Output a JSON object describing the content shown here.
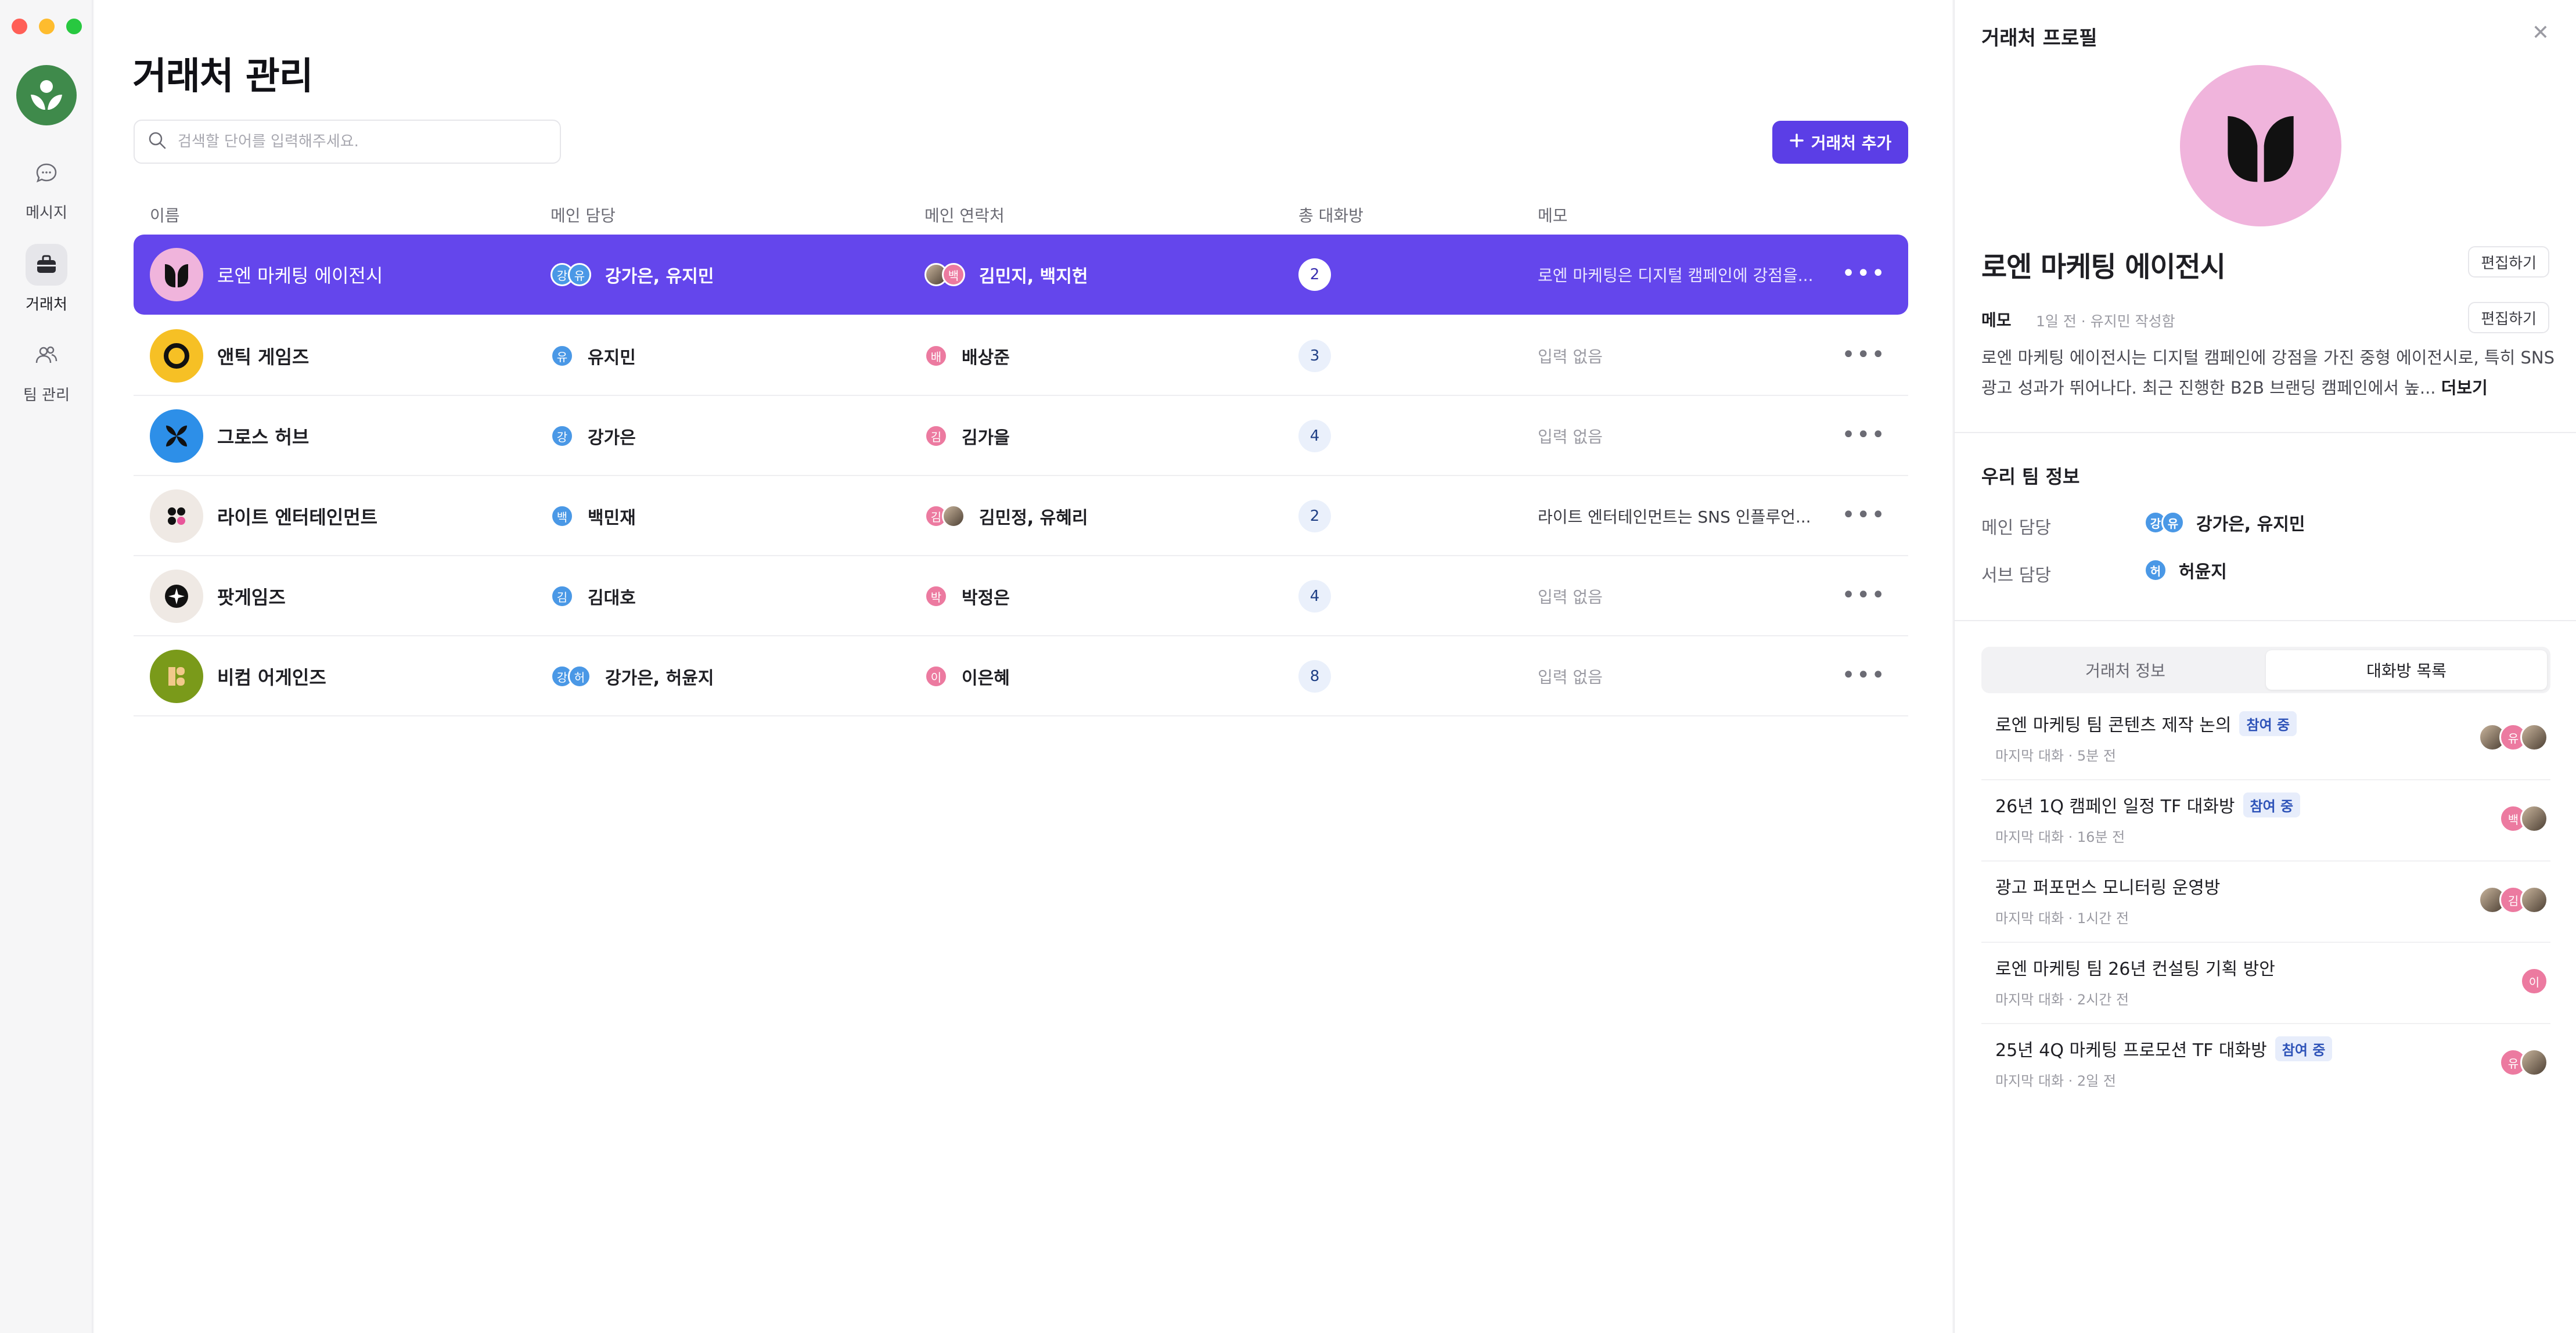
{
  "sidebar": {
    "items": [
      {
        "label": "메시지",
        "icon": "chat-bubble-icon",
        "active": false
      },
      {
        "label": "거래처",
        "icon": "briefcase-icon",
        "active": true
      },
      {
        "label": "팀 관리",
        "icon": "people-icon",
        "active": false
      }
    ]
  },
  "main": {
    "title": "거래처 관리",
    "search_placeholder": "검색할 단어를 입력해주세요.",
    "add_button": "거래처 추가",
    "columns": [
      "이름",
      "메인 담당",
      "메인 연락처",
      "총 대화방",
      "메모"
    ],
    "rows": [
      {
        "name": "로엔 마케팅 에이전시",
        "managers": "강가은, 유지민",
        "manager_initials": [
          "강",
          "유"
        ],
        "contacts": "김민지, 백지헌",
        "contact_initials": [
          "",
          "백"
        ],
        "count": "2",
        "memo": "로엔 마케팅은 디지털 캠페인에 강점을...",
        "memo_filled": true,
        "selected": true
      },
      {
        "name": "앤틱 게임즈",
        "managers": "유지민",
        "manager_initials": [
          "유"
        ],
        "contacts": "배상준",
        "contact_initials": [
          "배"
        ],
        "count": "3",
        "memo": "입력 없음",
        "memo_filled": false
      },
      {
        "name": "그로스 허브",
        "managers": "강가은",
        "manager_initials": [
          "강"
        ],
        "contacts": "김가을",
        "contact_initials": [
          "김"
        ],
        "count": "4",
        "memo": "입력 없음",
        "memo_filled": false
      },
      {
        "name": "라이트 엔터테인먼트",
        "managers": "백민재",
        "manager_initials": [
          "백"
        ],
        "contacts": "김민정, 유혜리",
        "contact_initials": [
          "김",
          ""
        ],
        "count": "2",
        "memo": "라이트 엔터테인먼트는 SNS 인플루언...",
        "memo_filled": true
      },
      {
        "name": "팟게임즈",
        "managers": "김대호",
        "manager_initials": [
          "김"
        ],
        "contacts": "박정은",
        "contact_initials": [
          "박"
        ],
        "count": "4",
        "memo": "입력 없음",
        "memo_filled": false
      },
      {
        "name": "비컴 어게인즈",
        "managers": "강가은, 허윤지",
        "manager_initials": [
          "강",
          "허"
        ],
        "contacts": "이은혜",
        "contact_initials": [
          "이"
        ],
        "count": "8",
        "memo": "입력 없음",
        "memo_filled": false
      }
    ]
  },
  "panel": {
    "title": "거래처 프로필",
    "name": "로엔 마케팅 에이전시",
    "edit_label": "편집하기",
    "memo_label": "메모",
    "memo_meta": "1일 전 · 유지민 작성함",
    "memo_text": "로엔 마케팅 에이전시는 디지털 캠페인에 강점을 가진 중형 에이전시로, 특히 SNS 광고 성과가 뛰어나다. 최근 진행한 B2B 브랜딩 캠페인에서 높...",
    "more_label": "더보기",
    "team_section": "우리 팀 정보",
    "main_manager_label": "메인 담당",
    "main_manager_value": "강가은, 유지민",
    "main_manager_initials": [
      "강",
      "유"
    ],
    "sub_manager_label": "서브 담당",
    "sub_manager_value": "허윤지",
    "sub_manager_initials": [
      "허"
    ],
    "tabs": [
      "거래처 정보",
      "대화방 목록"
    ],
    "active_tab": 1,
    "chats": [
      {
        "title": "로엔 마케팅 팀 콘텐츠 제작 논의",
        "badge": "참여 중",
        "meta": "마지막 대화 · 5분 전",
        "avatars": [
          "",
          "유",
          ""
        ]
      },
      {
        "title": "26년 1Q 캠페인 일정 TF 대화방",
        "badge": "참여 중",
        "meta": "마지막 대화 · 16분 전",
        "avatars": [
          "백",
          ""
        ]
      },
      {
        "title": "광고 퍼포먼스 모니터링 운영방",
        "badge": "",
        "meta": "마지막 대화 · 1시간 전",
        "avatars": [
          "",
          "김",
          ""
        ]
      },
      {
        "title": "로엔 마케팅 팀 26년 컨설팅 기획 방안",
        "badge": "",
        "meta": "마지막 대화 · 2시간 전",
        "avatars": [
          "이"
        ]
      },
      {
        "title": "25년 4Q 마케팅 프로모션 TF 대화방",
        "badge": "참여 중",
        "meta": "마지막 대화 · 2일 전",
        "avatars": [
          "유",
          ""
        ]
      }
    ]
  },
  "colors": {
    "accent": "#6446ec",
    "button": "#5b3ee6",
    "avatar_blue": "#4a98e6",
    "avatar_pink": "#ec7aa0"
  }
}
